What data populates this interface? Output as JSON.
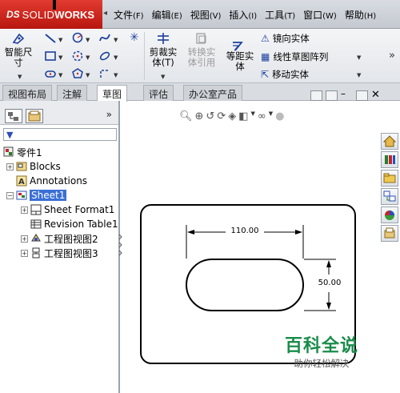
{
  "app": {
    "logo_ds": "DS",
    "logo_solid": "SOLID",
    "logo_works": "WORKS"
  },
  "menu": [
    {
      "label": "文件",
      "key": "(F)"
    },
    {
      "label": "编辑",
      "key": "(E)"
    },
    {
      "label": "视图",
      "key": "(V)"
    },
    {
      "label": "插入",
      "key": "(I)"
    },
    {
      "label": "工具",
      "key": "(T)"
    },
    {
      "label": "窗口",
      "key": "(W)"
    },
    {
      "label": "帮助",
      "key": "(H)"
    }
  ],
  "ribbon": {
    "smart_dim_line1": "智能尺",
    "smart_dim_line2": "寸",
    "trim_line1": "剪裁实",
    "trim_line2": "体(T)",
    "convert_line1": "转换实",
    "convert_line2": "体引用",
    "offset_line1": "等距实",
    "offset_line2": "体",
    "mirror": "镜向实体",
    "linear_pattern": "线性草图阵列",
    "move": "移动实体",
    "more": "»"
  },
  "tabs": [
    {
      "label": "视图布局",
      "active": false
    },
    {
      "label": "注解",
      "active": false
    },
    {
      "label": "草图",
      "active": true
    },
    {
      "label": "评估",
      "active": false
    },
    {
      "label": "办公室产品",
      "active": false
    }
  ],
  "panel": {
    "expand": "»",
    "tree": {
      "root": "零件1",
      "blocks": "Blocks",
      "annotations": "Annotations",
      "sheet": "Sheet1",
      "sheet_format": "Sheet Format1",
      "revision_table": "Revision Table1",
      "view2": "工程图视图2",
      "view3": "工程图视图3"
    }
  },
  "drawing": {
    "dim_horizontal": "110.00",
    "dim_vertical": "50.00"
  },
  "watermark": {
    "title": "百科全说",
    "subtitle": "助你轻松解决"
  },
  "colors": {
    "brand_red": "#c8201a",
    "selection_blue": "#3b6fd6",
    "watermark_green": "#1a8c4a"
  }
}
